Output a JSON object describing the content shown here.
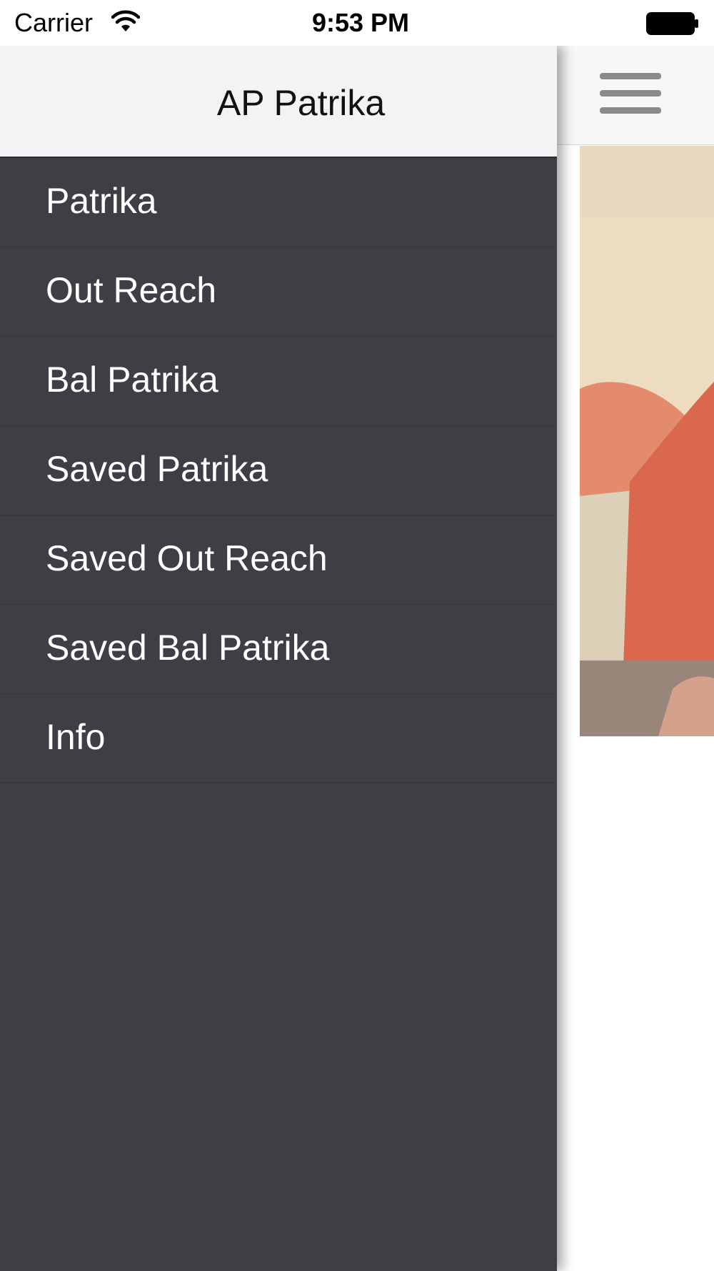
{
  "status_bar": {
    "carrier": "Carrier",
    "time": "9:53 PM",
    "wifi_icon": "wifi-icon",
    "battery_icon": "battery-icon"
  },
  "drawer": {
    "title": "AP Patrika",
    "background_color": "#3e3f45",
    "header_color": "#f3f3f5",
    "items": [
      {
        "label": "Patrika"
      },
      {
        "label": "Out Reach"
      },
      {
        "label": "Bal Patrika"
      },
      {
        "label": "Saved Patrika"
      },
      {
        "label": "Saved Out Reach"
      },
      {
        "label": "Saved Bal Patrika"
      },
      {
        "label": "Info"
      }
    ]
  },
  "main": {
    "menu_icon": "hamburger-menu-icon",
    "hero_image": "photo"
  }
}
